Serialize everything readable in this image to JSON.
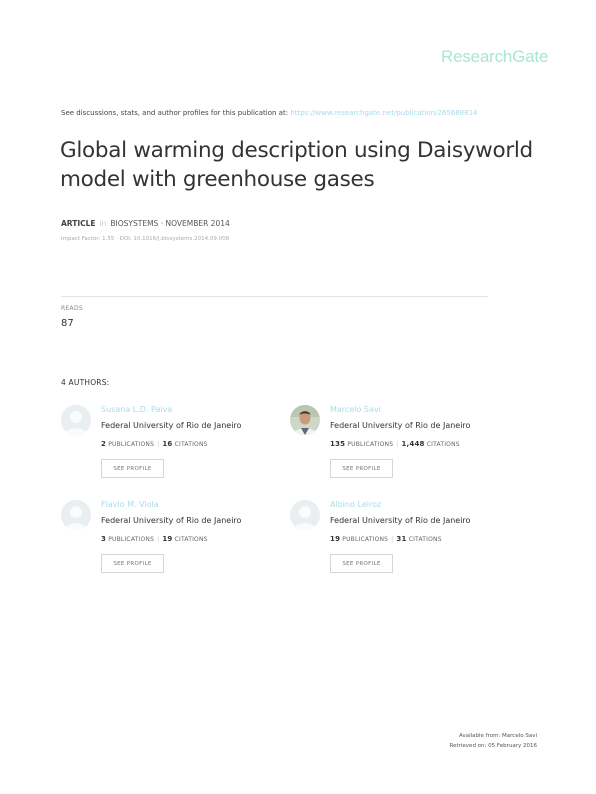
{
  "brand": {
    "logo": "ResearchGate"
  },
  "header": {
    "disclaimer": "See discussions, stats, and author profiles for this publication at:",
    "url": "https://www.researchgate.net/publication/265688814"
  },
  "article": {
    "title": "Global warming description using Daisyworld model with greenhouse gases",
    "type": "ARTICLE",
    "in_word": "in",
    "journal": "BIOSYSTEMS · NOVEMBER 2014",
    "impact": "Impact Factor: 1.55 · DOI: 10.1016/j.biosystems.2014.09.008"
  },
  "reads": {
    "label": "READS",
    "value": "87"
  },
  "authors_heading": "4 AUTHORS:",
  "authors": [
    {
      "name": "Susana L.D. Paiva",
      "institution": "Federal University of Rio de Janeiro",
      "publications": "2",
      "pub_label": "PUBLICATIONS",
      "citations": "16",
      "cit_label": "CITATIONS",
      "button": "SEE PROFILE",
      "avatar": "default-avatar-icon"
    },
    {
      "name": "Marcelo Savi",
      "institution": "Federal University of Rio de Janeiro",
      "publications": "135",
      "pub_label": "PUBLICATIONS",
      "citations": "1,448",
      "cit_label": "CITATIONS",
      "button": "SEE PROFILE",
      "avatar": "photo-avatar"
    },
    {
      "name": "Flavio M. Viola",
      "institution": "Federal University of Rio de Janeiro",
      "publications": "3",
      "pub_label": "PUBLICATIONS",
      "citations": "19",
      "cit_label": "CITATIONS",
      "button": "SEE PROFILE",
      "avatar": "default-avatar-icon"
    },
    {
      "name": "Albino Leiroz",
      "institution": "Federal University of Rio de Janeiro",
      "publications": "19",
      "pub_label": "PUBLICATIONS",
      "citations": "31",
      "cit_label": "CITATIONS",
      "button": "SEE PROFILE",
      "avatar": "default-avatar-icon"
    }
  ],
  "footer": {
    "available": "Available from: Marcelo Savi",
    "retrieved": "Retrieved on: 05 February 2016"
  },
  "colors": {
    "brand": "#a8e6d6",
    "link": "#a9dbe8",
    "text": "#333333"
  }
}
